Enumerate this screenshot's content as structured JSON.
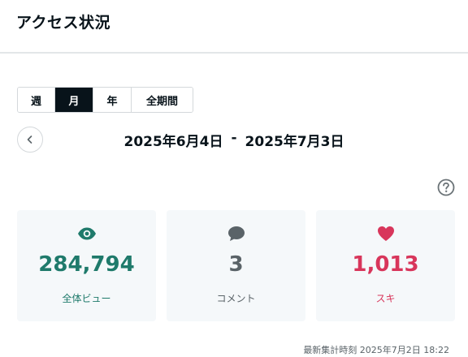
{
  "header": {
    "title": "アクセス状況"
  },
  "period_tabs": [
    {
      "label": "週",
      "active": false
    },
    {
      "label": "月",
      "active": true
    },
    {
      "label": "年",
      "active": false
    },
    {
      "label": "全期間",
      "active": false
    }
  ],
  "date_range": {
    "start": "2025年6月4日",
    "separator": "-",
    "end": "2025年7月3日"
  },
  "stats": {
    "views": {
      "value": "284,794",
      "label": "全体ビュー",
      "color": "#1f7a6b",
      "icon": "eye-icon"
    },
    "comments": {
      "value": "3",
      "label": "コメント",
      "color": "#5a6368",
      "icon": "comment-icon"
    },
    "likes": {
      "value": "1,013",
      "label": "スキ",
      "color": "#d8365b",
      "icon": "heart-icon"
    }
  },
  "footer": {
    "updated": "最新集計時刻 2025年7月2日 18:22"
  }
}
